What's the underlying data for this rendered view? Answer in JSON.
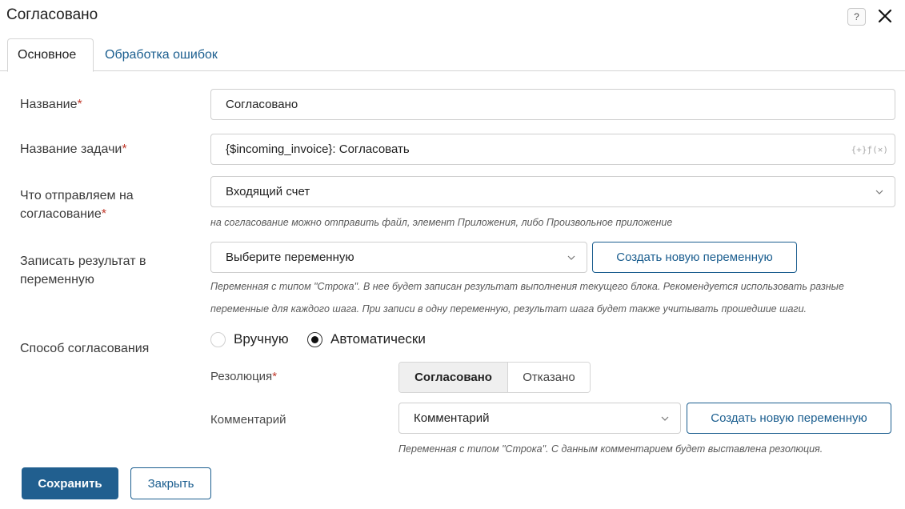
{
  "dialog": {
    "title": "Согласовано",
    "help_glyph": "?"
  },
  "tabs": [
    {
      "label": "Основное"
    },
    {
      "label": "Обработка ошибок"
    }
  ],
  "fields": {
    "name": {
      "label": "Название",
      "required_mark": "*",
      "value": "Согласовано"
    },
    "task_name": {
      "label": "Название задачи",
      "required_mark": "*",
      "value": "{$incoming_invoice}: Согласовать",
      "fx_glyph": "{+}ƒ(×)"
    },
    "send": {
      "label_line1": "Что отправляем на",
      "label_line2": "согласование",
      "required_mark": "*",
      "value": "Входящий счет",
      "hint": "на согласование можно отправить файл, элемент Приложения, либо Произвольное приложение"
    },
    "result_var": {
      "label_line1": "Записать результат в",
      "label_line2": "переменную",
      "value": "Выберите переменную",
      "create_btn": "Создать новую переменную",
      "hint_line1": "Переменная с типом \"Строка\". В нее будет записан результат выполнения текущего блока. Рекомендуется использовать разные",
      "hint_line2": "переменные для каждого шага. При записи в одну переменную, результат шага будет также учитывать прошедшие шаги."
    },
    "method": {
      "label": "Способ согласования",
      "option_manual": "Вручную",
      "option_auto": "Автоматически"
    },
    "resolution": {
      "label": "Резолюция",
      "required_mark": "*",
      "option_approved": "Согласовано",
      "option_rejected": "Отказано"
    },
    "comment": {
      "label": "Комментарий",
      "value": "Комментарий",
      "create_btn": "Создать новую переменную",
      "hint": "Переменная с типом \"Строка\". С данным комментарием будет выставлена резолюция."
    }
  },
  "footer": {
    "save": "Сохранить",
    "close": "Закрыть"
  }
}
